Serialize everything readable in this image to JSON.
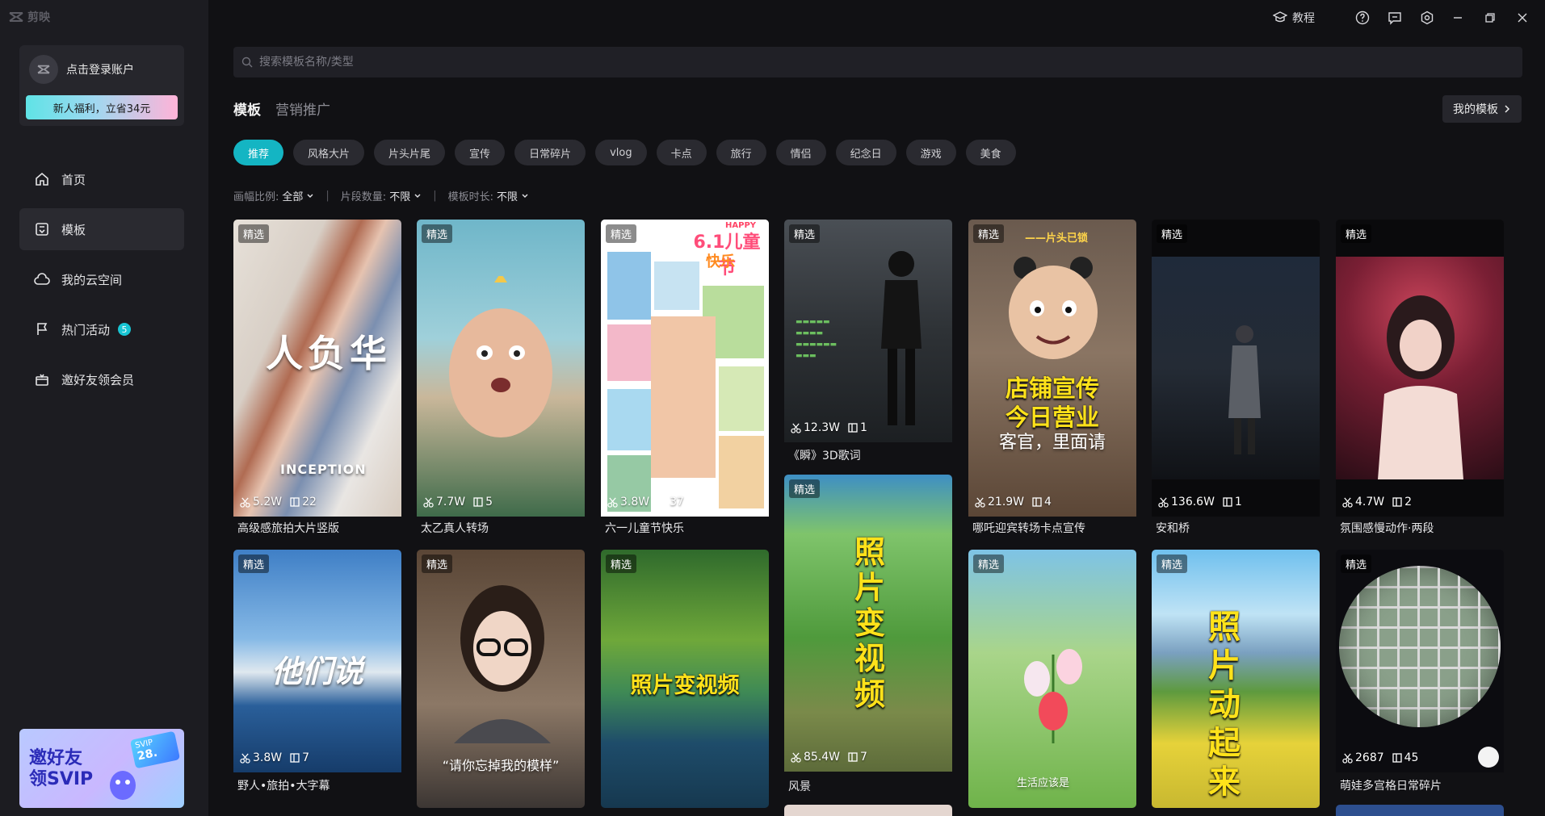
{
  "app": {
    "logo_text": "剪映"
  },
  "sidebar": {
    "login_text": "点击登录账户",
    "promo_label": "新人福利，立省34元",
    "nav": [
      {
        "label": "首页",
        "icon": "home-icon"
      },
      {
        "label": "模板",
        "icon": "template-icon"
      },
      {
        "label": "我的云空间",
        "icon": "cloud-icon"
      },
      {
        "label": "热门活动",
        "icon": "flag-icon",
        "badge": "5"
      },
      {
        "label": "邀好友领会员",
        "icon": "gift-icon"
      }
    ],
    "svip_banner": {
      "line1": "邀好友",
      "line2": "领SVIP",
      "card_label": "SVIP",
      "card_value": "28."
    }
  },
  "titlebar": {
    "tutorial_label": "教程"
  },
  "search": {
    "placeholder": "搜索模板名称/类型"
  },
  "tabs": [
    {
      "label": "模板",
      "active": true
    },
    {
      "label": "营销推广",
      "active": false
    }
  ],
  "my_templates_label": "我的模板",
  "chips": [
    "推荐",
    "风格大片",
    "片头片尾",
    "宣传",
    "日常碎片",
    "vlog",
    "卡点",
    "旅行",
    "情侣",
    "纪念日",
    "游戏",
    "美食"
  ],
  "filters": [
    {
      "label": "画幅比例:",
      "value": "全部"
    },
    {
      "label": "片段数量:",
      "value": "不限"
    },
    {
      "label": "模板时长:",
      "value": "不限"
    }
  ],
  "tag_label": "精选",
  "cards": {
    "c1": {
      "title": "高级感旅拍大片竖版",
      "uses": "5.2W",
      "clips": "22",
      "overlay1": "人负华",
      "overlay2": "INCEPTION"
    },
    "c2": {
      "title": "太乙真人转场",
      "uses": "7.7W",
      "clips": "5"
    },
    "c3": {
      "title": "六一儿童节快乐",
      "uses": "3.8W",
      "clips": "37",
      "overlay1": "6.1儿童节",
      "overlay2": "快乐",
      "overlay3": "HAPPY"
    },
    "c4": {
      "title": "《瞬》3D歌词",
      "uses": "12.3W",
      "clips": "1"
    },
    "c5": {
      "title": "哪吒迎宾转场卡点宣传",
      "uses": "21.9W",
      "clips": "4",
      "overlay1": "——片头已锁",
      "overlay2": "店铺宣传",
      "overlay3": "今日营业",
      "overlay4": "客官，里面请"
    },
    "c6": {
      "title": "安和桥",
      "uses": "136.6W",
      "clips": "1"
    },
    "c7": {
      "title": "氛围感慢动作·两段",
      "uses": "4.7W",
      "clips": "2"
    },
    "c8": {
      "title": "野人•旅拍•大字幕",
      "uses": "3.8W",
      "clips": "7",
      "overlay1": "他们说"
    },
    "c9": {
      "overlay1": "“请你忘掉我的模样”"
    },
    "c10": {
      "overlay1": "照片变视频"
    },
    "c11": {
      "title": "风景",
      "uses": "85.4W",
      "clips": "7",
      "overlay1": "照片变视频"
    },
    "c12": {
      "overlay1": "生活应该是"
    },
    "c13": {
      "overlay1": "照片动起来"
    },
    "c14": {
      "title": "萌娃多宫格日常碎片",
      "uses": "2687",
      "clips": "45"
    }
  }
}
